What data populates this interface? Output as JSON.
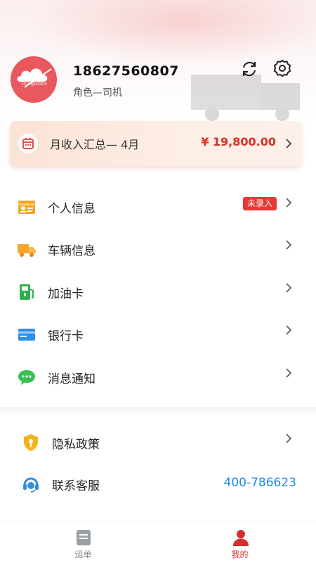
{
  "profile": {
    "avatar_text": "Tclogistics",
    "phone": "18627560807",
    "role": "角色—司机",
    "refresh_icon": "refresh-icon",
    "settings_icon": "gear-icon"
  },
  "income": {
    "title": "月收入汇总— 4月",
    "amount": "¥ 19,800.00",
    "icon": "calendar-icon"
  },
  "menu": [
    {
      "label": "个人信息",
      "icon": "id-card-icon",
      "badge": "未录入"
    },
    {
      "label": "车辆信息",
      "icon": "truck-icon"
    },
    {
      "label": "加油卡",
      "icon": "fuel-pump-icon"
    },
    {
      "label": "银行卡",
      "icon": "bank-card-icon"
    },
    {
      "label": "消息通知",
      "icon": "chat-bubble-icon"
    }
  ],
  "menu2": [
    {
      "label": "隐私政策",
      "icon": "shield-icon"
    },
    {
      "label": "联系客服",
      "icon": "headset-icon",
      "value": "400-786623"
    }
  ],
  "tabs": [
    {
      "label": "运单",
      "icon": "waybill-icon",
      "active": false
    },
    {
      "label": "我的",
      "icon": "user-icon",
      "active": true
    }
  ],
  "colors": {
    "accent": "#e53935",
    "amount": "#d93025",
    "link": "#1e88e5",
    "tab_active": "#d32f2f"
  }
}
